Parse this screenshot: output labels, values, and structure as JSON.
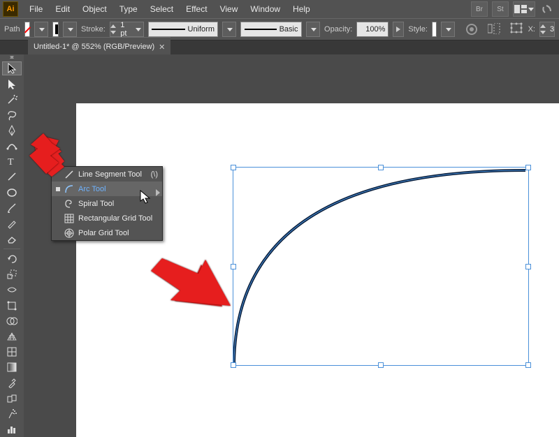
{
  "menubar": {
    "items": [
      "File",
      "Edit",
      "Object",
      "Type",
      "Select",
      "Effect",
      "View",
      "Window",
      "Help"
    ],
    "right_icons": [
      "bridge-icon",
      "stock-icon",
      "arrange-icon",
      "prefs-icon",
      "sync-icon"
    ]
  },
  "ctrlbar": {
    "selection_label": "Path",
    "stroke_label": "Stroke:",
    "stroke_value": "1 pt",
    "brush_label": "Uniform",
    "style_label": "Basic",
    "opacity_label": "Opacity:",
    "opacity_value": "100%",
    "style2_label": "Style:",
    "x_label": "X:",
    "x_value": "3"
  },
  "tab": {
    "title": "Untitled-1* @ 552% (RGB/Preview)"
  },
  "toolbar": {
    "tools": [
      {
        "name": "selection-tool"
      },
      {
        "name": "direct-selection-tool"
      },
      {
        "name": "magic-wand-tool"
      },
      {
        "name": "lasso-tool"
      },
      {
        "name": "pen-tool"
      },
      {
        "name": "curvature-tool"
      },
      {
        "name": "type-tool"
      },
      {
        "name": "line-tool"
      },
      {
        "name": "ellipse-tool"
      },
      {
        "name": "paintbrush-tool"
      },
      {
        "name": "pencil-tool"
      },
      {
        "name": "eraser-tool"
      }
    ],
    "tools2": [
      {
        "name": "rotate-tool"
      },
      {
        "name": "scale-tool"
      },
      {
        "name": "width-tool"
      },
      {
        "name": "free-transform-tool"
      },
      {
        "name": "shape-builder-tool"
      },
      {
        "name": "perspective-grid-tool"
      },
      {
        "name": "mesh-tool"
      },
      {
        "name": "gradient-tool"
      },
      {
        "name": "eyedropper-tool"
      },
      {
        "name": "blend-tool"
      },
      {
        "name": "symbol-sprayer-tool"
      },
      {
        "name": "column-graph-tool"
      }
    ]
  },
  "flyout": {
    "items": [
      {
        "label": "Line Segment Tool",
        "shortcut": "(\\)",
        "active": false
      },
      {
        "label": "Arc Tool",
        "shortcut": "",
        "active": true
      },
      {
        "label": "Spiral Tool",
        "shortcut": "",
        "active": false
      },
      {
        "label": "Rectangular Grid Tool",
        "shortcut": "",
        "active": false
      },
      {
        "label": "Polar Grid Tool",
        "shortcut": "",
        "active": false
      }
    ]
  }
}
